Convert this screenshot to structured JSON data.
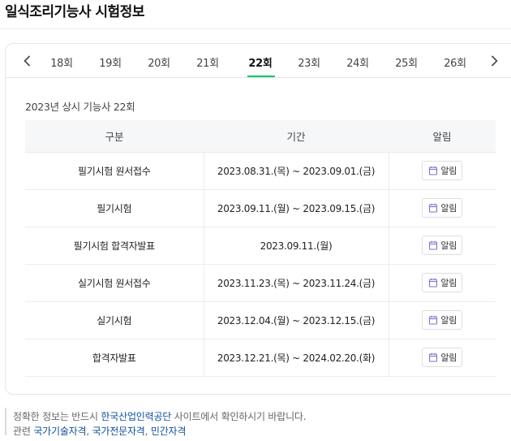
{
  "page": {
    "title": "일식조리기능사 시험정보"
  },
  "tabs": {
    "items": [
      "18회",
      "19회",
      "20회",
      "21회",
      "22회",
      "23회",
      "24회",
      "25회",
      "26회"
    ],
    "active_index": 4
  },
  "section": {
    "title": "2023년 상시 기능사 22회"
  },
  "table": {
    "headers": [
      "구분",
      "기간",
      "알림"
    ],
    "rows": [
      {
        "category": "필기시험 원서접수",
        "period": "2023.08.31.(목) ~ 2023.09.01.(금)",
        "alarm": "알림"
      },
      {
        "category": "필기시험",
        "period": "2023.09.11.(월) ~ 2023.09.15.(금)",
        "alarm": "알림"
      },
      {
        "category": "필기시험 합격자발표",
        "period": "2023.09.11.(월)",
        "alarm": "알림"
      },
      {
        "category": "실기시험 원서접수",
        "period": "2023.11.23.(목) ~ 2023.11.24.(금)",
        "alarm": "알림"
      },
      {
        "category": "실기시험",
        "period": "2023.12.04.(월) ~ 2023.12.15.(금)",
        "alarm": "알림"
      },
      {
        "category": "합격자발표",
        "period": "2023.12.21.(목) ~ 2024.02.20.(화)",
        "alarm": "알림"
      }
    ]
  },
  "notice": {
    "line1_prefix": "정확한 정보는 반드시",
    "line1_link": "한국산업인력공단",
    "line1_suffix": "사이트에서 확인하시기 바랍니다.",
    "line2_prefix": "관련",
    "line2_links": [
      "국가기술자격",
      "국가전문자격",
      "민간자격"
    ]
  },
  "colors": {
    "active_tab_underline": "#03c75a",
    "link": "#0e4f9b",
    "alarm_icon": "#8a6bd1"
  },
  "icons": {
    "prev": "chevron-left-icon",
    "next": "chevron-right-icon",
    "alarm": "calendar-icon"
  }
}
